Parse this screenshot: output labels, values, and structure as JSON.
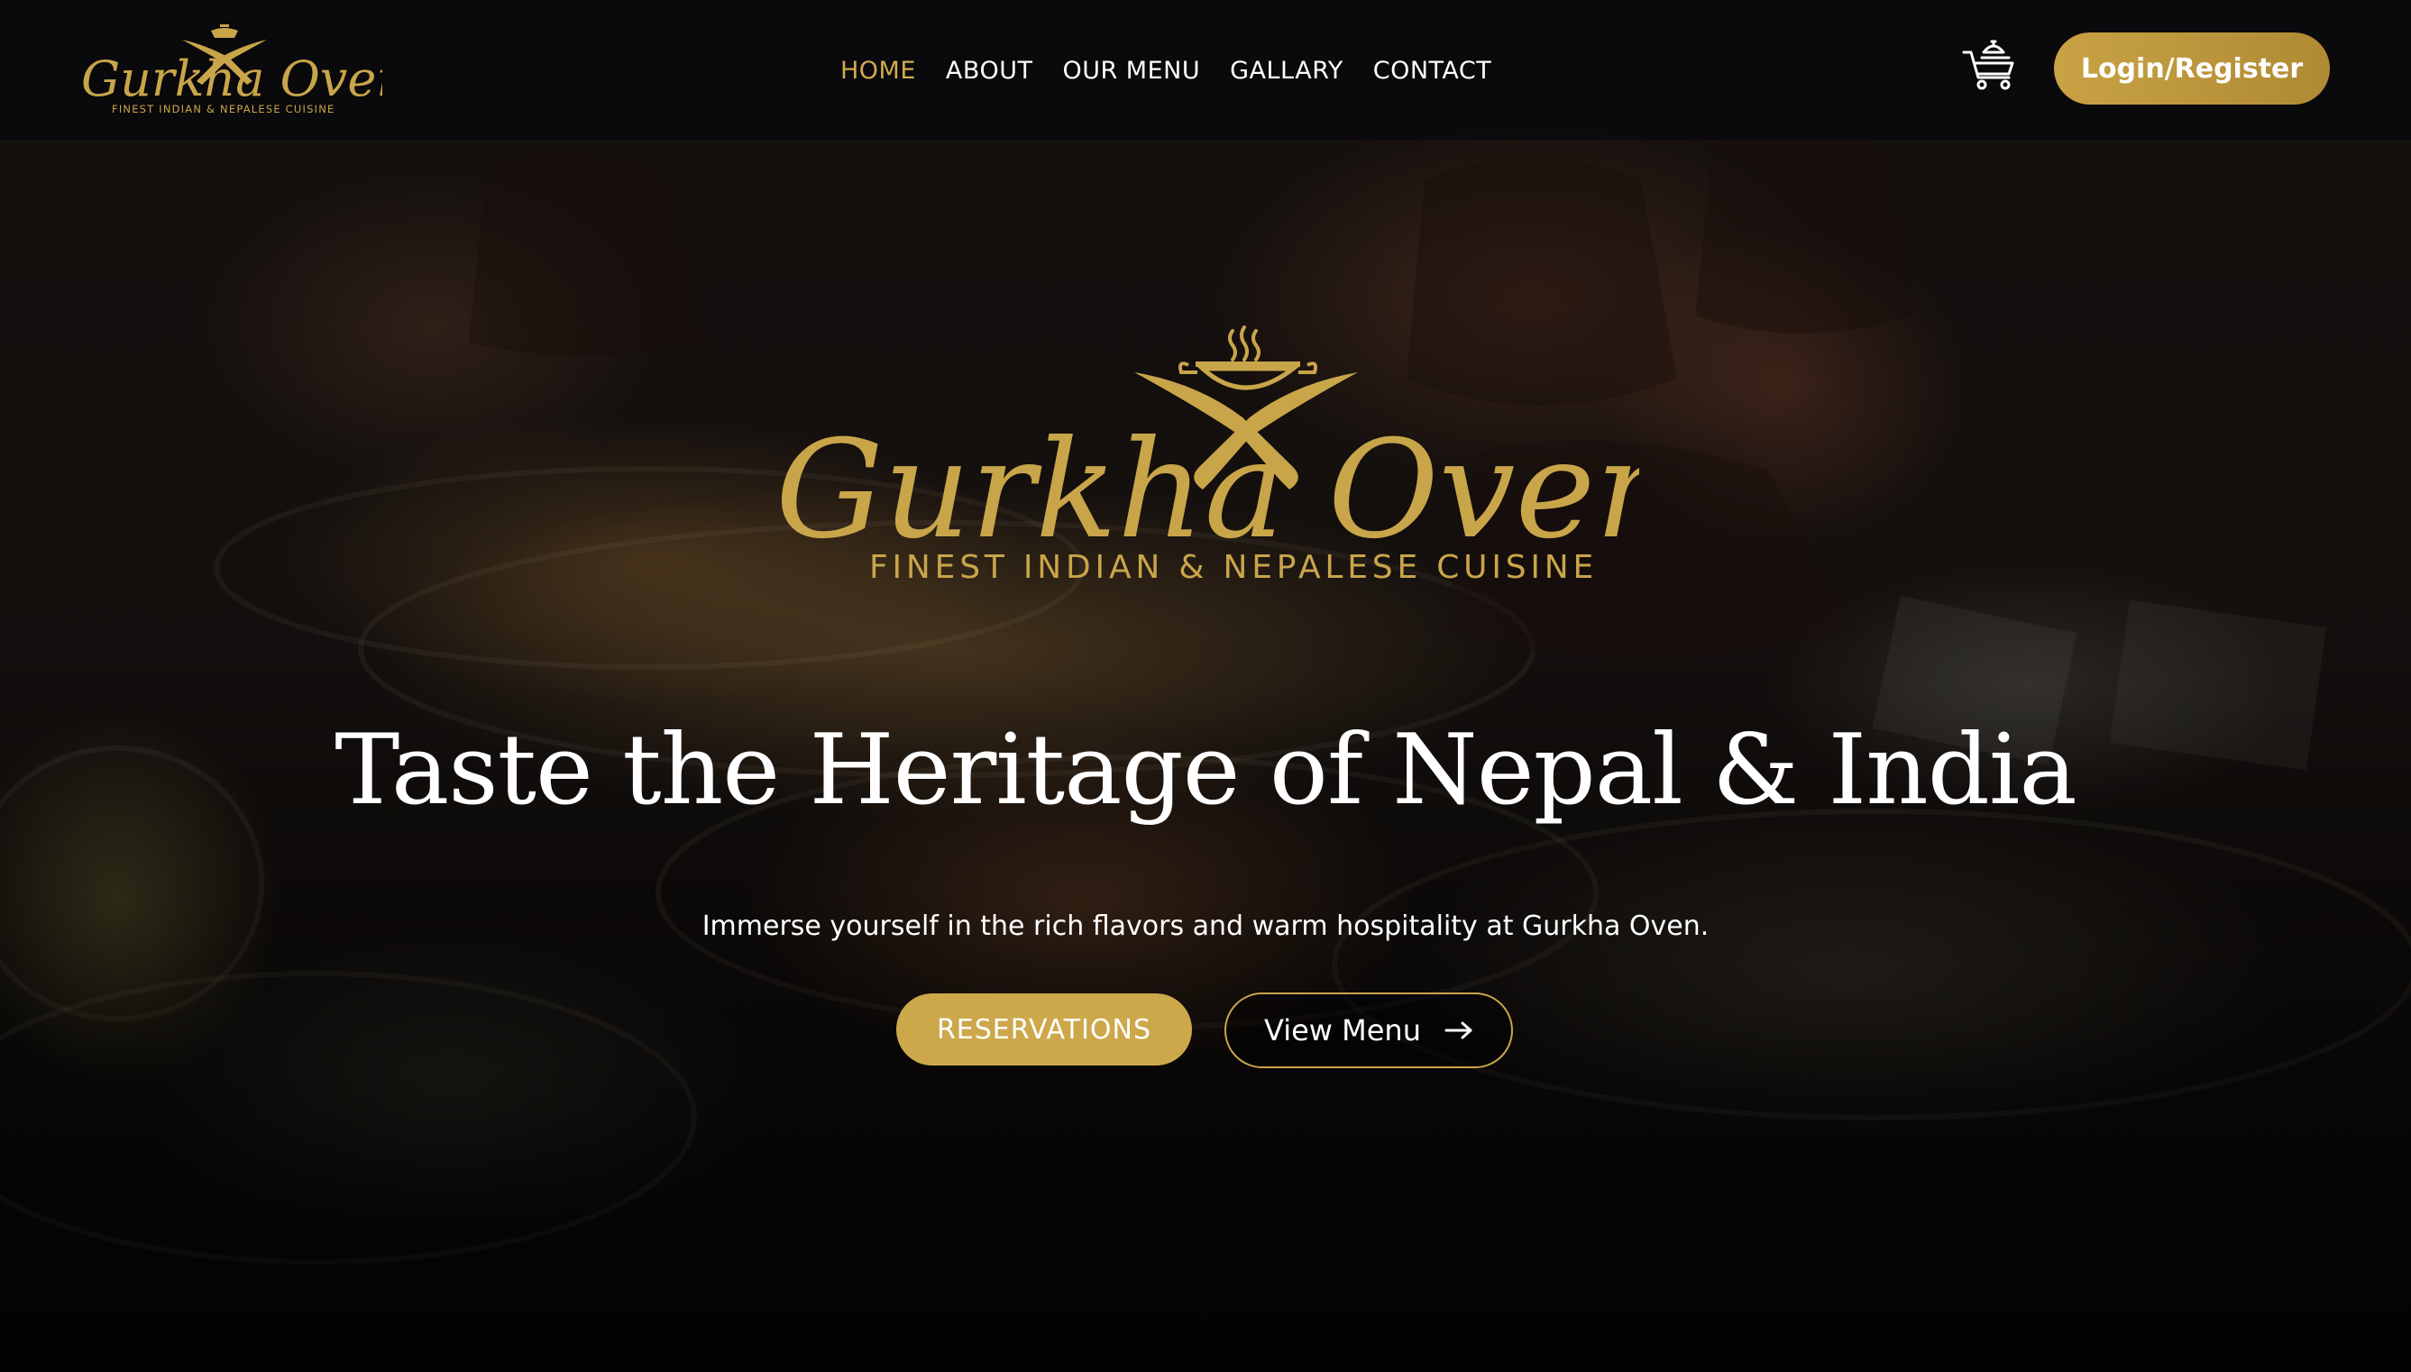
{
  "brand": {
    "name": "Gurkha Oven",
    "tagline": "FINEST INDIAN & NEPALESE CUISINE",
    "gold": "#c9a54a"
  },
  "nav": {
    "items": [
      {
        "label": "HOME",
        "active": true
      },
      {
        "label": "ABOUT",
        "active": false
      },
      {
        "label": "OUR MENU",
        "active": false
      },
      {
        "label": "GALLARY",
        "active": false
      },
      {
        "label": "CONTACT",
        "active": false
      }
    ],
    "cart_icon": "cart-icon",
    "login_label": "Login/Register"
  },
  "hero": {
    "title": "Taste the Heritage of Nepal & India",
    "subtitle": "Immerse yourself in the rich flavors and warm hospitality at Gurkha Oven.",
    "reservations_label": "RESERVATIONS",
    "view_menu_label": "View Menu",
    "view_menu_icon": "arrow-right-icon"
  },
  "colors": {
    "accent": "#cda84b",
    "active_nav": "#d2aa4f",
    "text": "#ffffff",
    "topbar_bg": "#08080c"
  }
}
